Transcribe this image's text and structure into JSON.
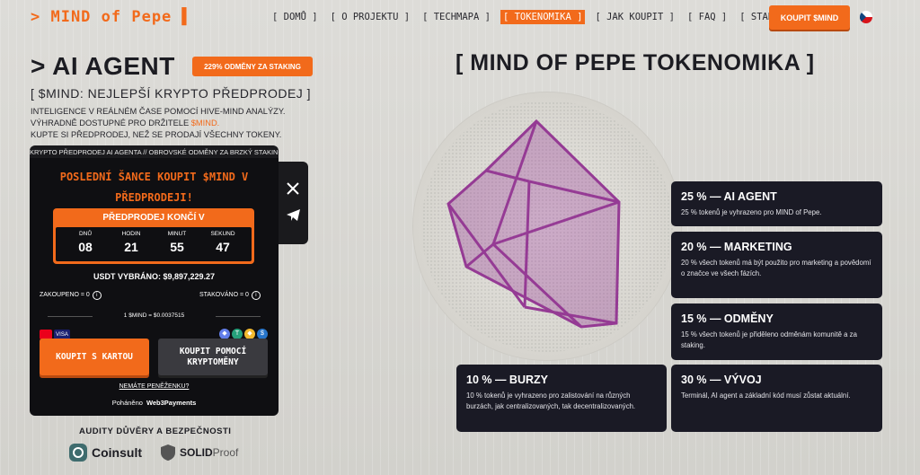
{
  "header": {
    "logo": "> MIND of Pepe ▌",
    "nav": [
      "[ DOMŮ ]",
      "[ O PROJEKTU ]",
      "[ TECHMAPA ]",
      "[ TOKENOMIKA ]",
      "[ JAK KOUPIT ]",
      "[ FAQ ]",
      "[ STAKING ]"
    ],
    "active_nav": "[ TOKENOMIKA ]",
    "buy_label": "KOUPIT $MIND",
    "flag_icon": "czech-flag-icon"
  },
  "hero": {
    "title": "> AI AGENT",
    "badge": "229% ODMĚNY ZA STAKING",
    "subtitle": "[ $MIND: NEJLEPŠÍ KRYPTO PŘEDPRODEJ ]",
    "desc_line1": "INTELIGENCE V REÁLNÉM ČASE POMOCÍ HIVE-MIND ANALÝZY.",
    "desc_line2_prefix": "VÝHRADNĚ DOSTUPNÉ PRO DRŽITELE ",
    "desc_line2_highlight": "$MIND.",
    "desc_line3": "KUPTE SI PŘEDPRODEJ, NEŽ SE PRODAJÍ VŠECHNY TOKENY."
  },
  "widget": {
    "ticker": "KRYPTO PŘEDPRODEJ AI AGENTA // OBROVSKÉ ODMĚNY ZA BRZKÝ STAKING",
    "title_line1": "POSLEDNÍ ŠANCE KOUPIT $MIND V",
    "title_line2": "PŘEDPRODEJI!",
    "countdown_label": "PŘEDPRODEJ KONČÍ V",
    "countdown": [
      {
        "unit": "DNŮ",
        "value": "08"
      },
      {
        "unit": "HODIN",
        "value": "21"
      },
      {
        "unit": "MINUT",
        "value": "55"
      },
      {
        "unit": "SEKUND",
        "value": "47"
      }
    ],
    "raised": "USDT VYBRÁNO: $9,897,229.27",
    "purchased": "ZAKOUPENO = 0",
    "staked": "STAKOVÁNO = 0",
    "rate": "1 $MIND = $0.0037515",
    "card_label": "VISA",
    "buy_card": "KOUPIT S KARTOU",
    "buy_crypto": "KOUPIT POMOCÍ KRYPTOMĚNY",
    "no_wallet": "NEMÁTE PENĚŽENKU?",
    "powered_prefix": "Poháněno",
    "powered_brand": "Web3Payments",
    "social": [
      "x-icon",
      "telegram-icon"
    ]
  },
  "audits": {
    "heading": "AUDITY DŮVĚRY A BEZPEČNOSTI",
    "coinsult": "Coinsult",
    "solid": "SOLID",
    "proof": "Proof"
  },
  "tokenomics": {
    "title": "[ MIND OF PEPE TOKENOMIKA ]",
    "cards": [
      {
        "title": "25 % — AI AGENT",
        "desc": "25 % tokenů je vyhrazeno pro MIND of Pepe."
      },
      {
        "title": "20 % — MARKETING",
        "desc": "20 % všech tokenů má být použito pro marketing a povědomí o značce ve všech fázích."
      },
      {
        "title": "15 % — ODMĚNY",
        "desc": "15 % všech tokenů je přiděleno odměnám komunitě a za staking."
      },
      {
        "title": "10 % — BURZY",
        "desc": "10 % tokenů je vyhrazeno pro zalistování na různých burzách, jak centralizovaných, tak decentralizovaných."
      },
      {
        "title": "30 % — VÝVOJ",
        "desc": "Terminál, AI agent a základní kód musí zůstat aktuální."
      }
    ]
  },
  "colors": {
    "accent": "#f26a1b",
    "card_bg": "#1a1a25",
    "cube": "#8e2a8e"
  }
}
